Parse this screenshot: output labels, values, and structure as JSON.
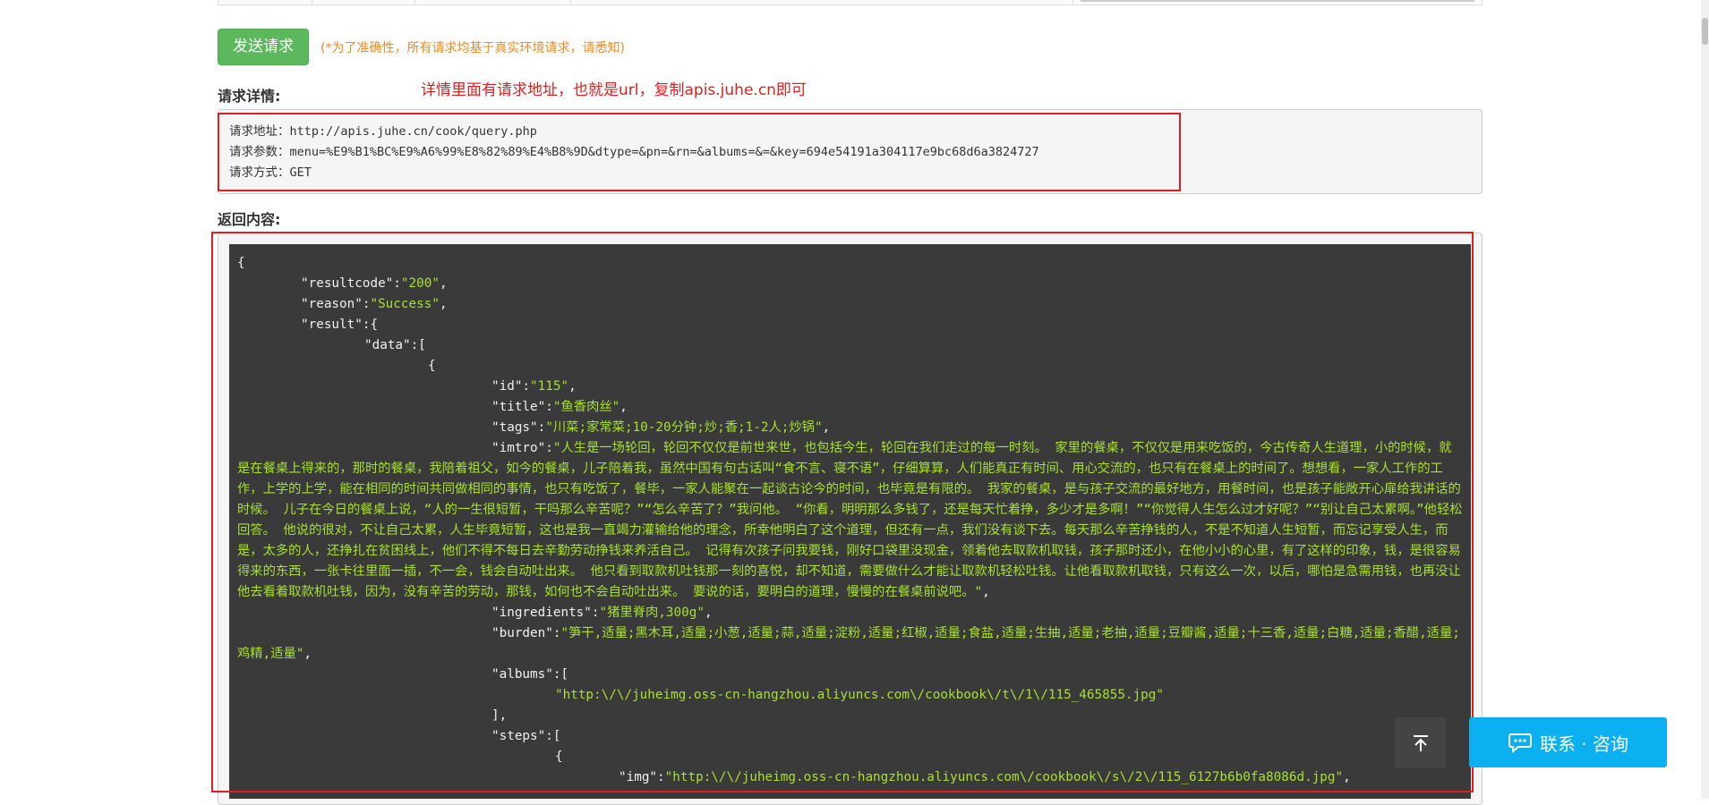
{
  "send_button_label": "发送请求",
  "send_note": "(*为了准确性，所有请求均基于真实环境请求，请悉知)",
  "detail_label": "请求详情:",
  "annotation": "详情里面有请求地址，也就是url，复制apis.juhe.cn即可",
  "detail": {
    "address": "请求地址：http://apis.juhe.cn/cook/query.php",
    "params": "请求参数：menu=%E9%B1%BC%E9%A6%99%E8%82%89%E4%B8%9D&dtype=&pn=&rn=&albums=&=&key=694e54191a304117e9bc68d6a3824727",
    "method": "请求方式：GET"
  },
  "response_label": "返回内容:",
  "response_lines": [
    {
      "indent": 0,
      "text": "{"
    },
    {
      "indent": 1,
      "key": "\"resultcode\"",
      "value": "\"200\"",
      "suffix": ","
    },
    {
      "indent": 1,
      "key": "\"reason\"",
      "value": "\"Success\"",
      "suffix": ","
    },
    {
      "indent": 1,
      "key": "\"result\"",
      "suffix": ":{"
    },
    {
      "indent": 2,
      "key": "\"data\"",
      "suffix": ":["
    },
    {
      "indent": 3,
      "text": "{"
    },
    {
      "indent": 4,
      "key": "\"id\"",
      "value": "\"115\"",
      "suffix": ","
    },
    {
      "indent": 4,
      "key": "\"title\"",
      "value": "\"鱼香肉丝\"",
      "suffix": ","
    },
    {
      "indent": 4,
      "key": "\"tags\"",
      "value": "\"川菜;家常菜;10-20分钟;炒;香;1-2人;炒锅\"",
      "suffix": ","
    },
    {
      "indent": 4,
      "wrap": true,
      "key": "\"imtro\"",
      "value": "\"人生是一场轮回，轮回不仅仅是前世来世，也包括今生，轮回在我们走过的每一时刻。 家里的餐桌，不仅仅是用来吃饭的，今古传奇人生道理，小的时候，就是在餐桌上得来的，那时的餐桌，我陪着祖父，如今的餐桌，儿子陪着我，虽然中国有句古话叫“食不言、寝不语”，仔细算算，人们能真正有时间、用心交流的，也只有在餐桌上的时间了。想想看，一家人工作的工作，上学的上学，能在相同的时间共同做相同的事情，也只有吃饭了，餐毕，一家人能聚在一起谈古论今的时间，也毕竟是有限的。 我家的餐桌，是与孩子交流的最好地方，用餐时间，也是孩子能敞开心扉给我讲话的时候。 儿子在今日的餐桌上说，“人的一生很短暂，干吗那么辛苦呢？”“怎么辛苦了？”我问他。 “你看，明明那么多钱了，还是每天忙着挣，多少才是多啊！”“你觉得人生怎么过才好呢？”“别让自己太累啊。”他轻松回答。 他说的很对，不让自己太累，人生毕竟短暂，这也是我一直竭力灌输给他的理念，所幸他明白了这个道理，但还有一点，我们没有谈下去。每天那么辛苦挣钱的人，不是不知道人生短暂，而忘记享受人生，而是，太多的人，还挣扎在贫困线上，他们不得不每日去辛勤劳动挣钱来养活自己。 记得有次孩子问我要钱，刚好口袋里没现金，领着他去取款机取钱，孩子那时还小，在他小小的心里，有了这样的印象，钱，是很容易得来的东西，一张卡往里面一插，不一会，钱会自动吐出来。 他只看到取款机吐钱那一刻的喜悦，却不知道，需要做什么才能让取款机轻松吐钱。让他看取款机取钱，只有这么一次，以后，哪怕是急需用钱，也再没让他去看着取款机吐钱，因为，没有辛苦的劳动，那钱，如何也不会自动吐出来。 要说的话，要明白的道理，慢慢的在餐桌前说吧。\"",
      "suffix": ","
    },
    {
      "indent": 4,
      "key": "\"ingredients\"",
      "value": "\"猪里脊肉,300g\"",
      "suffix": ","
    },
    {
      "indent": 4,
      "wrap": true,
      "key": "\"burden\"",
      "value": "\"笋干,适量;黑木耳,适量;小葱,适量;蒜,适量;淀粉,适量;红椒,适量;食盐,适量;生抽,适量;老抽,适量;豆瓣酱,适量;十三香,适量;白糖,适量;香醋,适量;鸡精,适量\"",
      "suffix": ","
    },
    {
      "indent": 4,
      "key": "\"albums\"",
      "suffix": ":["
    },
    {
      "indent": 5,
      "value": "\"http:\\/\\/juheimg.oss-cn-hangzhou.aliyuncs.com\\/cookbook\\/t\\/1\\/115_465855.jpg\""
    },
    {
      "indent": 4,
      "text": "],"
    },
    {
      "indent": 4,
      "key": "\"steps\"",
      "suffix": ":["
    },
    {
      "indent": 5,
      "text": "{"
    },
    {
      "indent": 6,
      "key": "\"img\"",
      "value": "\"http:\\/\\/juheimg.oss-cn-hangzhou.aliyuncs.com\\/cookbook\\/s\\/2\\/115_6127b6b0fa8086d.jpg\"",
      "suffix": ","
    }
  ],
  "to_top_icon": "arrow-up-icon",
  "contact_label": "联系 · 咨询",
  "contact_icon": "chat-bubble-icon",
  "colors": {
    "send_button": "#5cb85c",
    "note": "#f08a24",
    "annotation": "#e02020",
    "code_bg": "#3a3a3a",
    "code_string": "#a6e22e",
    "contact_button": "#0ab0ef"
  }
}
